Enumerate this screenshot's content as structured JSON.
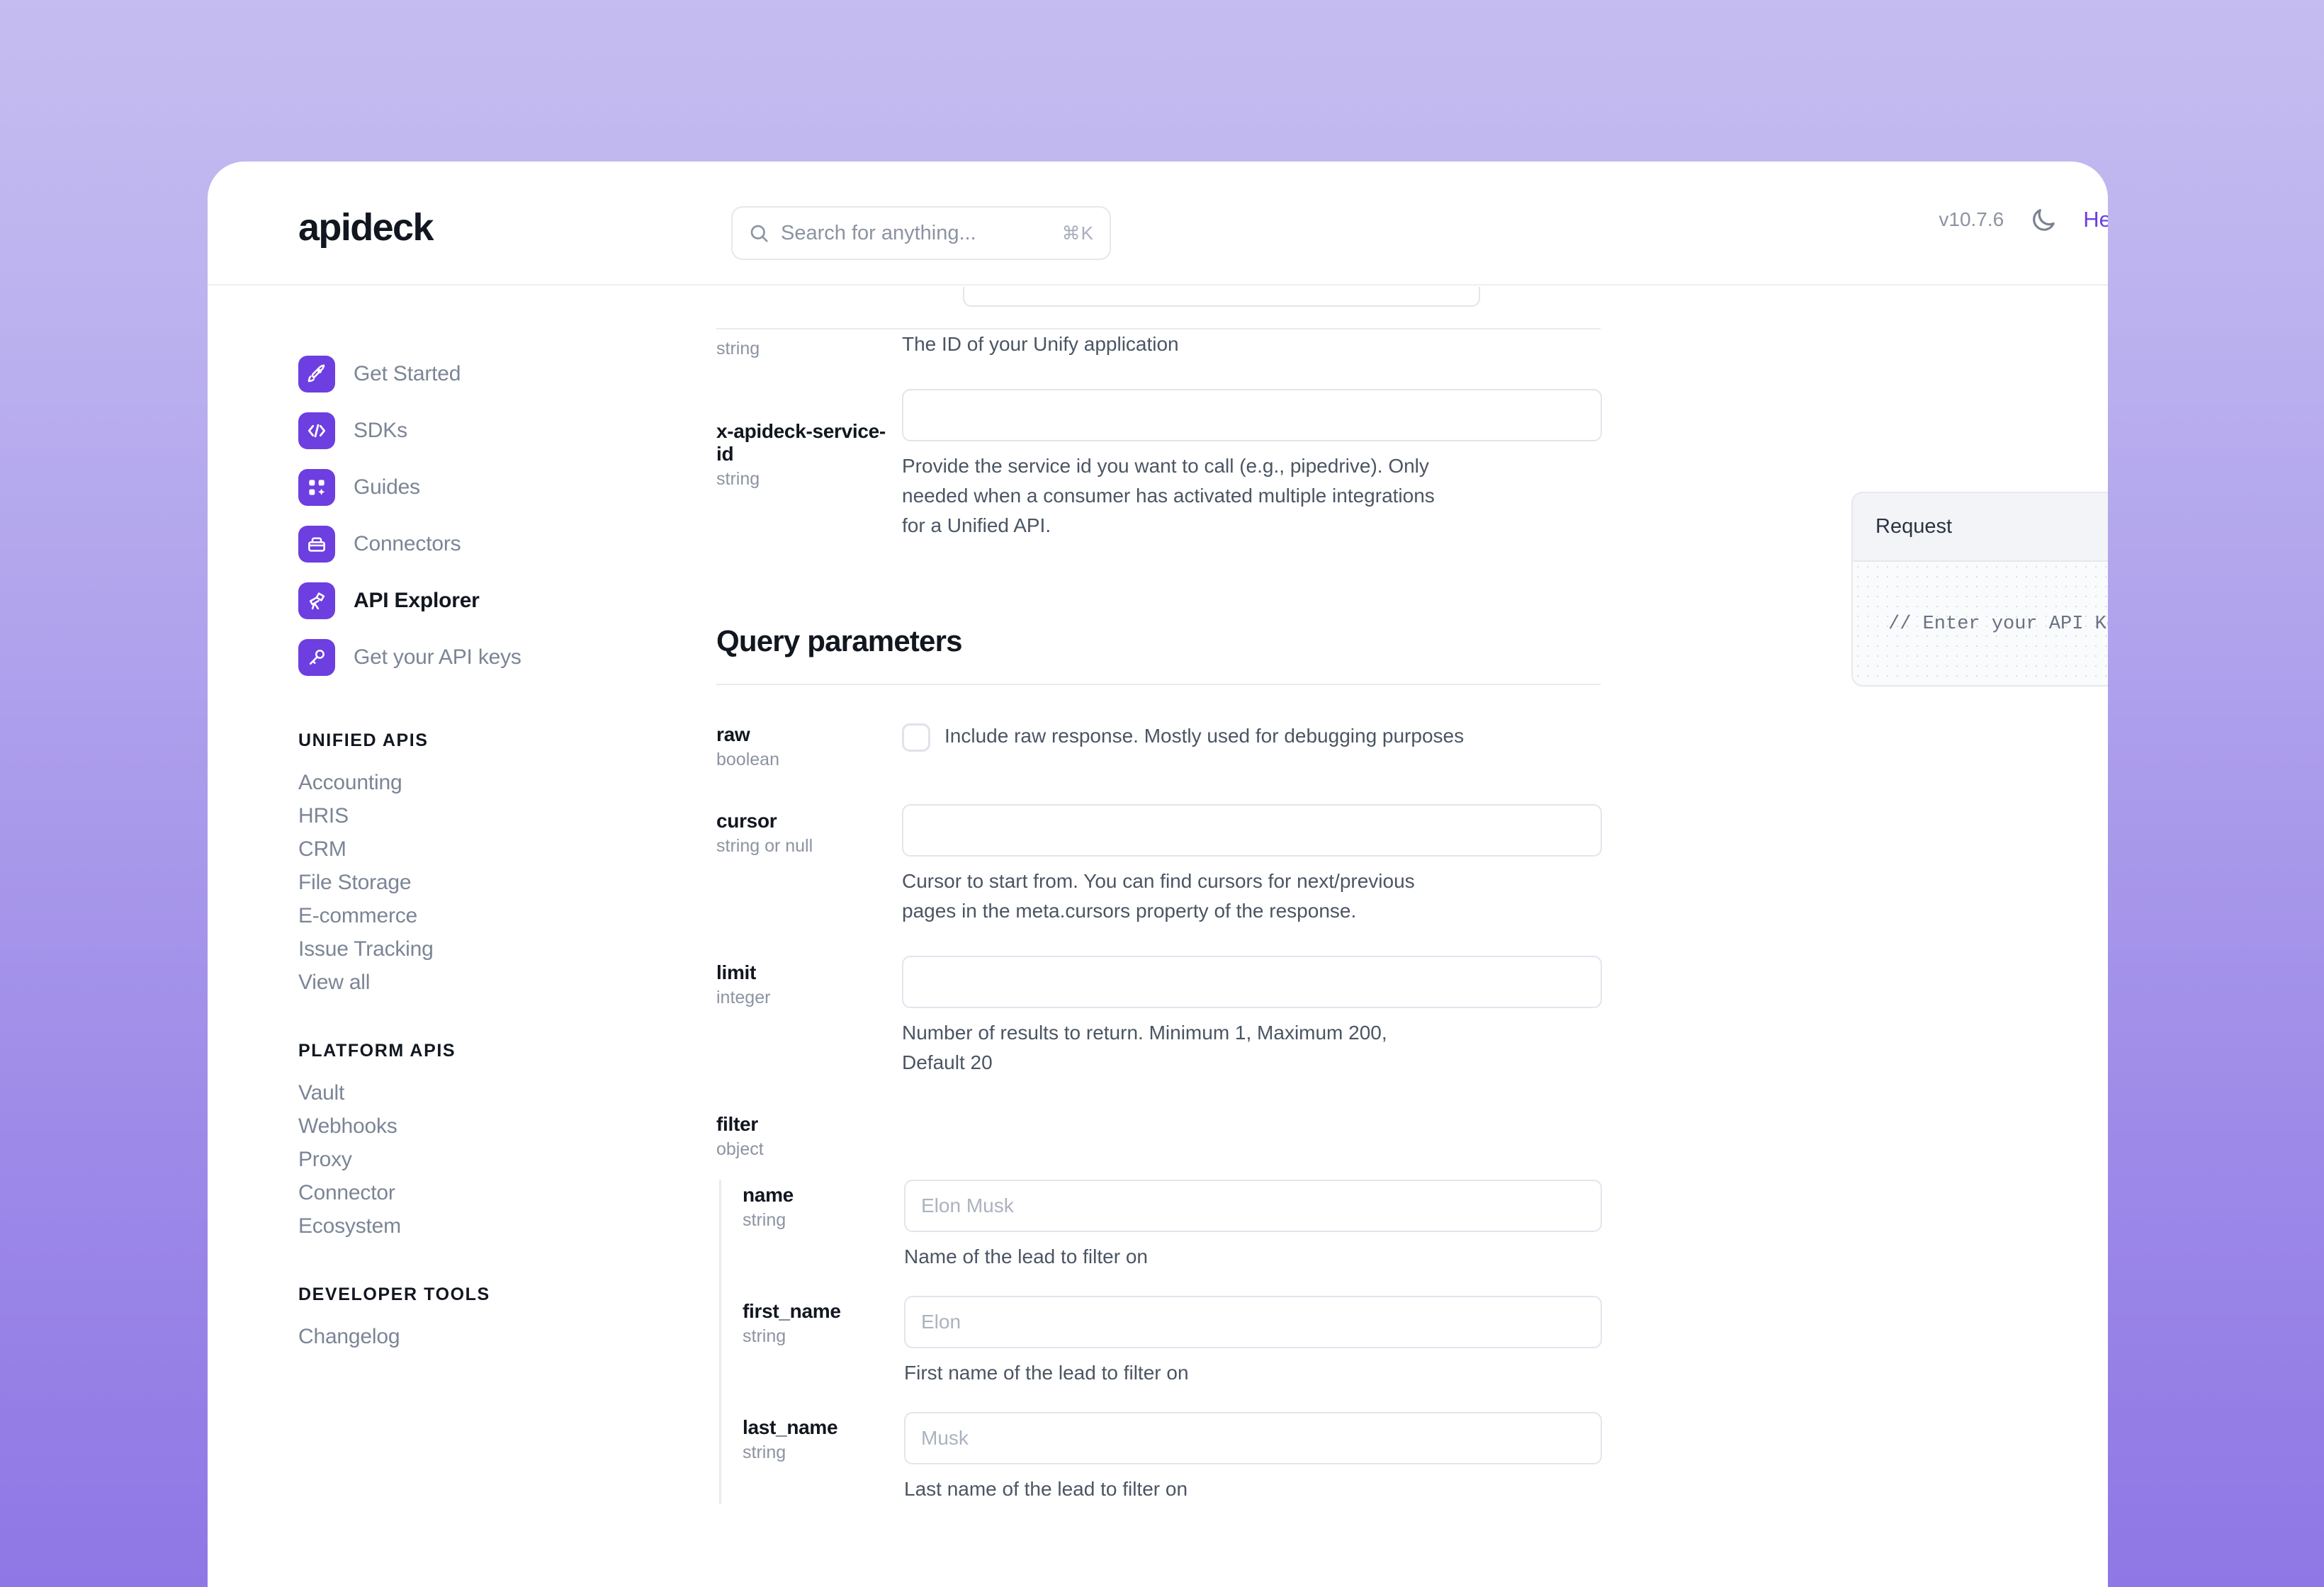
{
  "brand": {
    "name": "apideck"
  },
  "header": {
    "search": {
      "placeholder": "Search for anything...",
      "shortcut": "⌘K",
      "icon": "search-icon"
    },
    "version": "v10.7.6",
    "theme_toggle_icon": "moon-icon",
    "help_link": "Help C"
  },
  "sidebar": {
    "main_nav": [
      {
        "label": "Get Started",
        "icon": "rocket-icon",
        "active": false
      },
      {
        "label": "SDKs",
        "icon": "code-brackets-icon",
        "active": false
      },
      {
        "label": "Guides",
        "icon": "grid-sparkle-icon",
        "active": false
      },
      {
        "label": "Connectors",
        "icon": "box-icon",
        "active": false
      },
      {
        "label": "API Explorer",
        "icon": "telescope-icon",
        "active": true
      },
      {
        "label": "Get your API keys",
        "icon": "key-icon",
        "active": false
      }
    ],
    "sections": [
      {
        "title": "UNIFIED APIS",
        "links": [
          "Accounting",
          "HRIS",
          "CRM",
          "File Storage",
          "E-commerce",
          "Issue Tracking",
          "View all"
        ]
      },
      {
        "title": "PLATFORM APIS",
        "links": [
          "Vault",
          "Webhooks",
          "Proxy",
          "Connector",
          "Ecosystem"
        ]
      },
      {
        "title": "DEVELOPER TOOLS",
        "links": [
          "Changelog"
        ]
      }
    ]
  },
  "main": {
    "header_params": [
      {
        "name": "",
        "type": "string",
        "control": "input",
        "value": "",
        "help": "The ID of your Unify application"
      },
      {
        "name": "x-apideck-service-id",
        "type": "string",
        "control": "input",
        "value": "",
        "help": "Provide the service id you want to call (e.g., pipedrive). Only needed when a consumer has activated multiple integrations for a Unified API."
      }
    ],
    "query_section_title": "Query parameters",
    "query_params": [
      {
        "name": "raw",
        "type": "boolean",
        "control": "checkbox",
        "checked": false,
        "checkbox_label": "Include raw response. Mostly used for debugging purposes"
      },
      {
        "name": "cursor",
        "type": "string or null",
        "control": "input",
        "value": "",
        "help": "Cursor to start from. You can find cursors for next/previous pages in the meta.cursors property of the response."
      },
      {
        "name": "limit",
        "type": "integer",
        "control": "input",
        "value": "",
        "help": "Number of results to return. Minimum 1, Maximum 200, Default 20"
      }
    ],
    "filter_param": {
      "name": "filter",
      "type": "object",
      "fields": [
        {
          "name": "name",
          "type": "string",
          "placeholder": "Elon Musk",
          "help": "Name of the lead to filter on"
        },
        {
          "name": "first_name",
          "type": "string",
          "placeholder": "Elon",
          "help": "First name of the lead to filter on"
        },
        {
          "name": "last_name",
          "type": "string",
          "placeholder": "Musk",
          "help": "Last name of the lead to filter on"
        }
      ]
    }
  },
  "request_panel": {
    "title": "Request",
    "code": "// Enter your API Key and required params"
  },
  "colors": {
    "brand_purple": "#6d3ee0",
    "link_purple": "#6d3ee0",
    "text_dark": "#11161f",
    "text_muted": "#7b8596",
    "border": "#e6e8ee"
  }
}
